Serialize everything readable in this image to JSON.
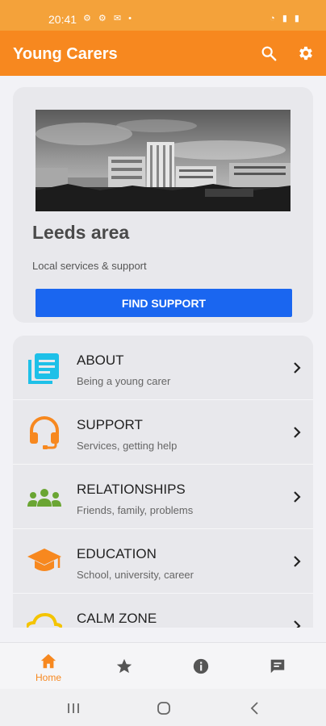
{
  "status_bar": {
    "time": "20:41",
    "left_icons": "⚙ ⚙ ✉ •",
    "right_icons": "◔ ▮ ▮"
  },
  "app_bar": {
    "title": "Young Carers",
    "icons": [
      "search-icon",
      "gear-icon"
    ]
  },
  "hero": {
    "title": "Leeds area",
    "subtitle": "Local services & support",
    "button_label": "FIND SUPPORT"
  },
  "menu": {
    "items": [
      {
        "title": "ABOUT",
        "subtitle": "Being a young carer",
        "icon": "document-list-icon",
        "color": "#1ec0e8"
      },
      {
        "title": "SUPPORT",
        "subtitle": "Services, getting help",
        "icon": "headset-icon",
        "color": "#f7881f"
      },
      {
        "title": "RELATIONSHIPS",
        "subtitle": "Friends, family, problems",
        "icon": "people-group-icon",
        "color": "#6aa533"
      },
      {
        "title": "EDUCATION",
        "subtitle": "School, university, career",
        "icon": "graduation-cap-icon",
        "color": "#f7881f"
      },
      {
        "title": "CALM ZONE",
        "subtitle": "",
        "icon": "cloud-icon",
        "color": "#f4c400"
      }
    ]
  },
  "bottom_nav": {
    "home_label": "Home",
    "active_color": "#f7881f",
    "inactive_color": "#555555",
    "icons": [
      "home-icon",
      "star-icon",
      "info-icon",
      "chat-icon"
    ]
  },
  "colors": {
    "app_bar": "#f7881f",
    "status_bar": "#f4a23a",
    "button": "#1a66f0"
  }
}
